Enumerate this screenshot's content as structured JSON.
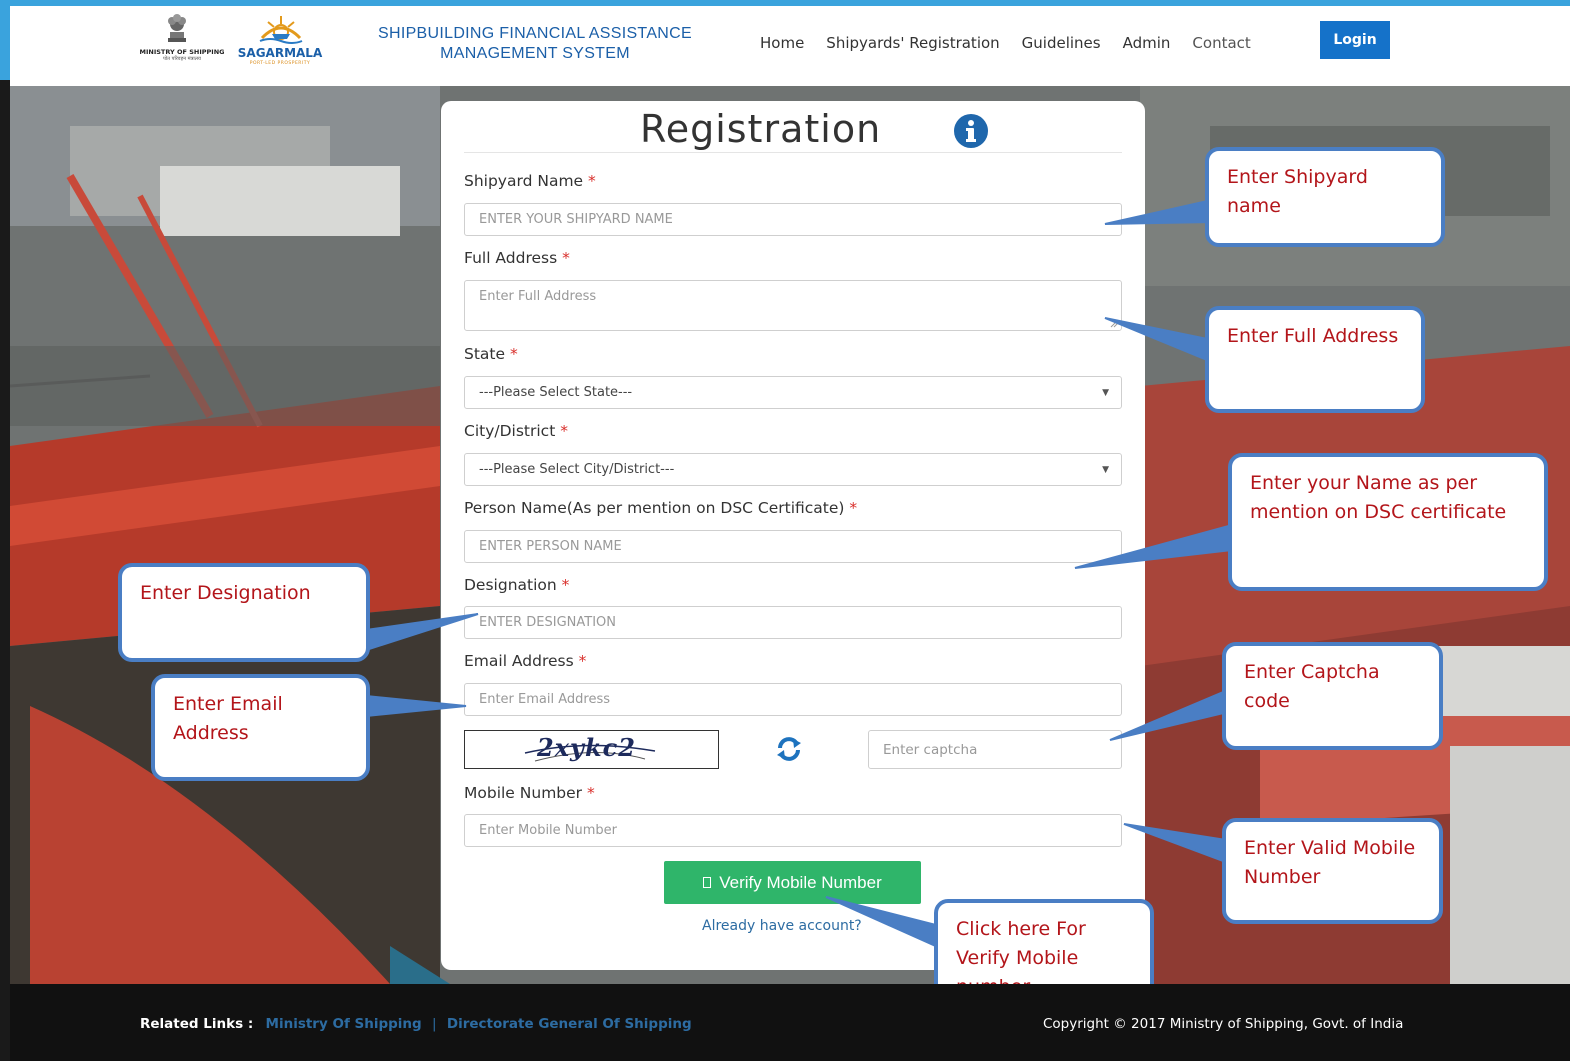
{
  "header": {
    "ministry_logo_text": "MINISTRY OF SHIPPING",
    "ministry_logo_sub": "पोत परिवहन मंत्रालय",
    "sagar_logo_text": "SAGARMALA",
    "sagar_logo_sub": "PORT-LED PROSPERITY",
    "app_title_line1": "SHIPBUILDING FINANCIAL ASSISTANCE",
    "app_title_line2": "MANAGEMENT SYSTEM",
    "nav": [
      "Home",
      "Shipyards' Registration",
      "Guidelines",
      "Admin",
      "Contact"
    ],
    "login_label": "Login"
  },
  "form": {
    "title": "Registration",
    "required_mark": "*",
    "fields": [
      {
        "label": "Shipyard Name",
        "placeholder": "ENTER YOUR SHIPYARD NAME"
      },
      {
        "label": "Full Address",
        "placeholder": "Enter Full Address"
      },
      {
        "label": "State",
        "value": "---Please Select State---"
      },
      {
        "label": "City/District",
        "value": "---Please Select City/District---"
      },
      {
        "label": "Person Name(As per mention on DSC Certificate)",
        "placeholder": "ENTER PERSON NAME"
      },
      {
        "label": "Designation",
        "placeholder": "ENTER DESIGNATION"
      },
      {
        "label": "Email Address",
        "placeholder": "Enter Email Address"
      },
      {
        "label": "Mobile Number",
        "placeholder": "Enter Mobile Number"
      }
    ],
    "captcha_text": "2xykc2",
    "captcha_placeholder": "Enter captcha",
    "verify_label": "Verify Mobile Number",
    "already_label": "Already have account?"
  },
  "callouts": {
    "shipyard": "Enter Shipyard name",
    "address": "Enter Full Address",
    "person": "Enter your Name as per mention on DSC certificate",
    "designation": "Enter Designation",
    "email": "Enter Email Address",
    "captcha": "Enter Captcha code",
    "mobile": "Enter Valid Mobile Number",
    "verify": "Click here For Verify Mobile number"
  },
  "footer": {
    "related_label": "Related Links :",
    "link1": "Ministry Of Shipping",
    "separator": "|",
    "link2": "Directorate General Of Shipping",
    "copyright": "Copyright © 2017 Ministry of Shipping, Govt. of India"
  },
  "colors": {
    "accent_blue": "#1572c9",
    "verify_green": "#2fb56a",
    "callout_border": "#4a7ec4",
    "callout_text": "#b3151a",
    "required_red": "#d9302c"
  }
}
